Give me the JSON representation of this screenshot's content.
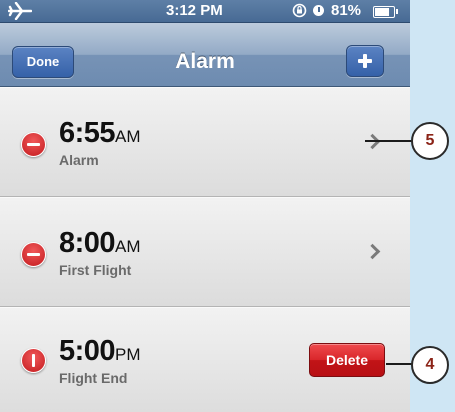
{
  "status_bar": {
    "time": "3:12 PM",
    "battery_text": "81%",
    "battery_level": 0.81,
    "icons": [
      "airplane-icon",
      "rotation-lock-icon",
      "alarm-icon",
      "battery-icon"
    ]
  },
  "nav": {
    "done_label": "Done",
    "title": "Alarm",
    "add_icon": "plus-icon"
  },
  "alarms": [
    {
      "time": "6:55",
      "ampm": "AM",
      "label": "Alarm"
    },
    {
      "time": "8:00",
      "ampm": "AM",
      "label": "First Flight"
    },
    {
      "time": "5:00",
      "ampm": "PM",
      "label": "Flight End",
      "delete_label": "Delete"
    }
  ],
  "callouts": [
    "5",
    "4"
  ],
  "colors": {
    "nav_blue": "#6d8bb0",
    "button_blue": "#3561a8",
    "delete_red": "#c21417",
    "callout_text": "#8b2317"
  }
}
